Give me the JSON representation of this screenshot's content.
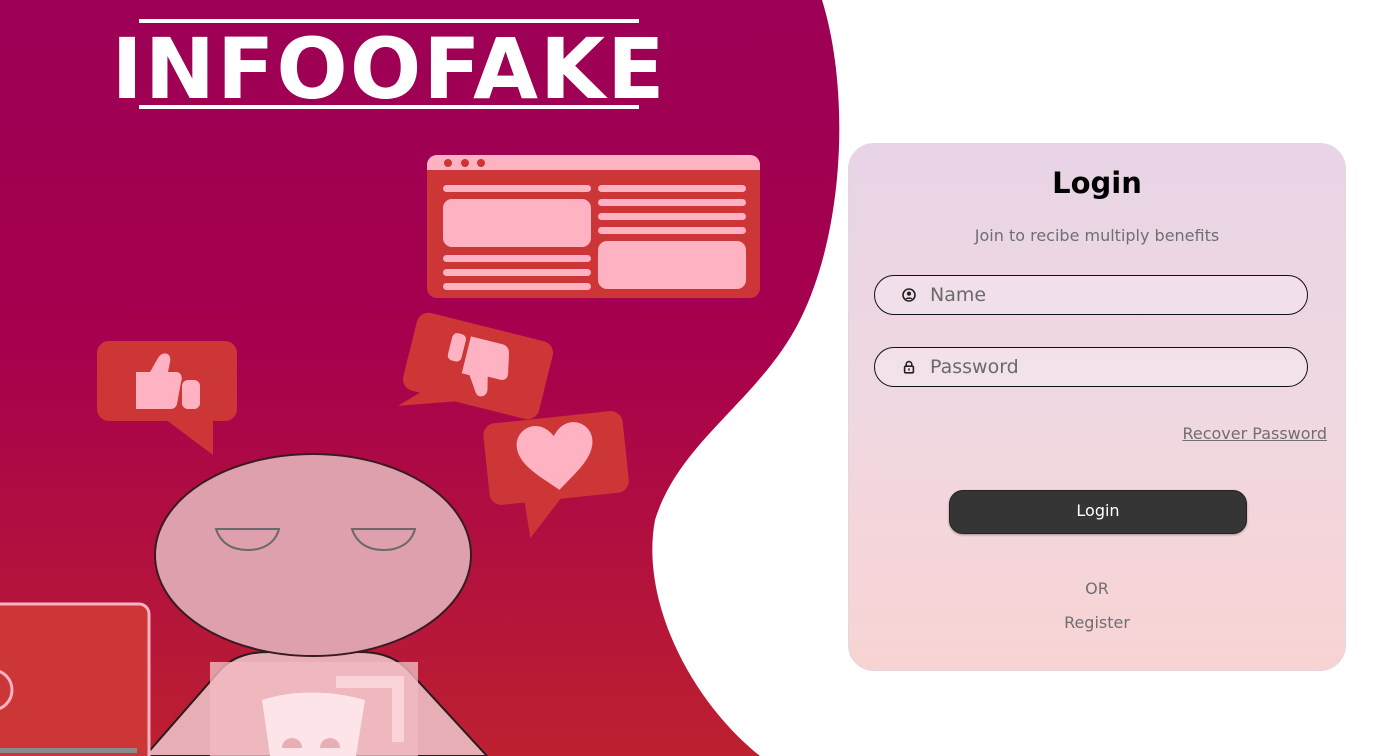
{
  "brand": {
    "logo_text": "INFOOFAKE"
  },
  "colors": {
    "hero_top": "#9c0055",
    "hero_bottom": "#bd2030",
    "card_top": "#e8d4e6",
    "card_bottom": "#f8d3d3",
    "button": "#353535",
    "bubble_red": "#cc3636",
    "bubble_pink": "#ffb2c1"
  },
  "illustration": {
    "elements": [
      "browser-window-icon",
      "thumbs-up-bubble-icon",
      "thumbs-down-bubble-icon",
      "heart-bubble-icon",
      "bored-person",
      "laptop"
    ]
  },
  "login": {
    "title": "Login",
    "subtitle": "Join to recibe multiply benefits",
    "name_placeholder": "Name",
    "name_icon": "user-circle-icon",
    "password_placeholder": "Password",
    "password_icon": "lock-icon",
    "recover_label": "Recover Password",
    "submit_label": "Login",
    "or_label": "OR",
    "register_label": "Register"
  }
}
